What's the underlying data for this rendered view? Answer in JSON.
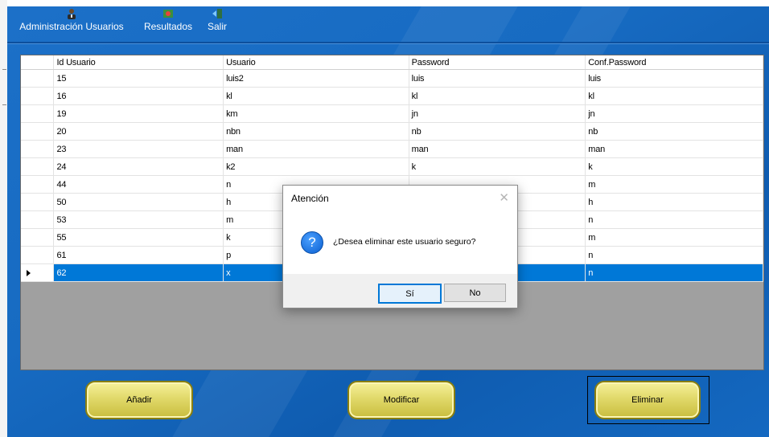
{
  "menu": {
    "items": [
      {
        "label": "Administración Usuarios",
        "icon": "user-admin-icon"
      },
      {
        "label": "Resultados",
        "icon": "results-icon"
      },
      {
        "label": "Salir",
        "icon": "exit-door-icon"
      }
    ]
  },
  "grid": {
    "columns": [
      "Id Usuario",
      "Usuario",
      "Password",
      "Conf.Password"
    ],
    "rows": [
      [
        "15",
        "luis2",
        "luis",
        "luis"
      ],
      [
        "16",
        "kl",
        "kl",
        "kl"
      ],
      [
        "19",
        "km",
        "jn",
        "jn"
      ],
      [
        "20",
        "nbn",
        "nb",
        "nb"
      ],
      [
        "23",
        "man",
        "man",
        "man"
      ],
      [
        "24",
        "k2",
        "k",
        "k"
      ],
      [
        "44",
        "n",
        "",
        "m"
      ],
      [
        "50",
        "h",
        "",
        "h"
      ],
      [
        "53",
        "m",
        "",
        "n"
      ],
      [
        "55",
        "k",
        "",
        "m"
      ],
      [
        "61",
        "p",
        "",
        "n"
      ],
      [
        "62",
        "x",
        "",
        "n"
      ]
    ],
    "selected_row_index": 11,
    "selection_color": "#0078d7"
  },
  "buttons": {
    "add": "Añadir",
    "modify": "Modificar",
    "delete": "Eliminar"
  },
  "dialog": {
    "title": "Atención",
    "close_icon": "close-icon",
    "icon": "question-icon",
    "message": "¿Desea eliminar este usuario seguro?",
    "yes": "Sí",
    "no": "No"
  },
  "colors": {
    "form_background": "#176bc2",
    "button_fill": "#e1d96a",
    "grid_background": "#a0a0a0"
  }
}
